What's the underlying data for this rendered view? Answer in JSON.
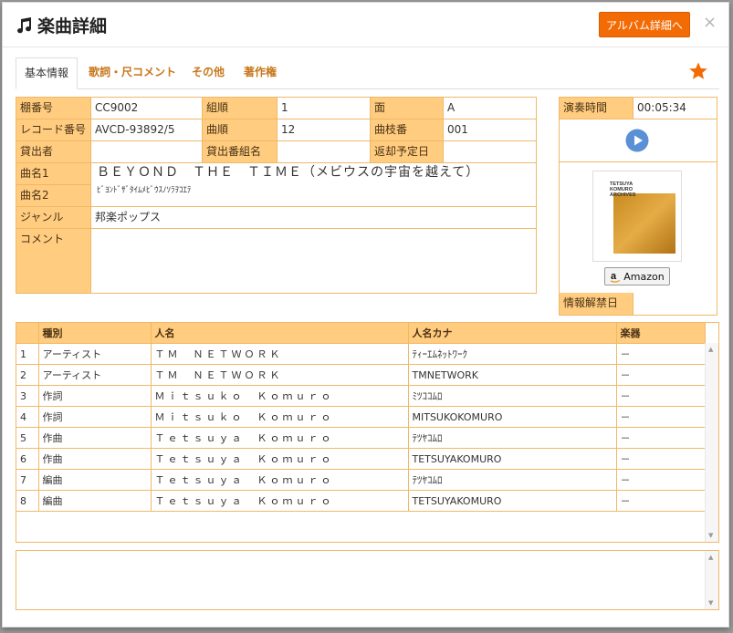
{
  "dialog": {
    "title": "楽曲詳細",
    "album_button": "アルバム詳細へ",
    "close_label": "×"
  },
  "tabs": [
    {
      "label": "基本情報"
    },
    {
      "label": "歌詞・尺コメント"
    },
    {
      "label": "その他"
    },
    {
      "label": "著作権"
    }
  ],
  "info": {
    "shelf_no_label": "棚番号",
    "shelf_no": "CC9002",
    "set_order_label": "組順",
    "set_order": "1",
    "side_label": "面",
    "side": "A",
    "record_no_label": "レコード番号",
    "record_no": "AVCD-93892/5",
    "track_label": "曲順",
    "track": "12",
    "branch_label": "曲枝番",
    "branch": "001",
    "borrower_label": "貸出者",
    "borrower": "",
    "loan_program_label": "貸出番組名",
    "loan_program": "",
    "return_date_label": "返却予定日",
    "return_date": "",
    "title1_label": "曲名1",
    "title1": "ＢＥＹＯＮＤ　ＴＨＥ　ＴＩＭＥ（メビウスの宇宙を越えて）",
    "title2_label": "曲名2",
    "title2": "ﾋﾞﾖﾝﾄﾞｻﾞﾀｲﾑﾒﾋﾞｳｽﾉｿﾗｦｺｴﾃ",
    "genre_label": "ジャンル",
    "genre": "邦楽ポップス",
    "comment_label": "コメント",
    "comment": ""
  },
  "side": {
    "duration_label": "演奏時間",
    "duration": "00:05:34",
    "jacket_text": [
      "TETSUYA",
      "KOMURO",
      "ARCHIVES"
    ],
    "amazon_label": "Amazon",
    "release_label": "情報解禁日",
    "release": ""
  },
  "credits": {
    "headers": [
      "",
      "種別",
      "人名",
      "人名カナ",
      "楽器"
    ],
    "rows": [
      [
        "1",
        "アーティスト",
        "ＴＭ　ＮＥＴＷＯＲＫ",
        "ﾃｨｰｴﾑﾈｯﾄﾜｰｸ",
        "－"
      ],
      [
        "2",
        "アーティスト",
        "ＴＭ　ＮＥＴＷＯＲＫ",
        "TMNETWORK",
        "－"
      ],
      [
        "3",
        "作詞",
        "Ｍｉｔｓｕｋｏ　Ｋｏｍｕｒｏ",
        "ﾐﾂｺｺﾑﾛ",
        "－"
      ],
      [
        "4",
        "作詞",
        "Ｍｉｔｓｕｋｏ　Ｋｏｍｕｒｏ",
        "MITSUKOKOMURO",
        "－"
      ],
      [
        "5",
        "作曲",
        "Ｔｅｔｓｕｙａ　Ｋｏｍｕｒｏ",
        "ﾃﾂﾔｺﾑﾛ",
        "－"
      ],
      [
        "6",
        "作曲",
        "Ｔｅｔｓｕｙａ　Ｋｏｍｕｒｏ",
        "TETSUYAKOMURO",
        "－"
      ],
      [
        "7",
        "編曲",
        "Ｔｅｔｓｕｙａ　Ｋｏｍｕｒｏ",
        "ﾃﾂﾔｺﾑﾛ",
        "－"
      ],
      [
        "8",
        "編曲",
        "Ｔｅｔｓｕｙａ　Ｋｏｍｕｒｏ",
        "TETSUYAKOMURO",
        "－"
      ]
    ]
  },
  "memo": {
    "value": ""
  },
  "colors": {
    "accent": "#f26b05",
    "label_bg": "#ffcc80",
    "border": "#f0b868",
    "play": "#5b8fd6"
  }
}
